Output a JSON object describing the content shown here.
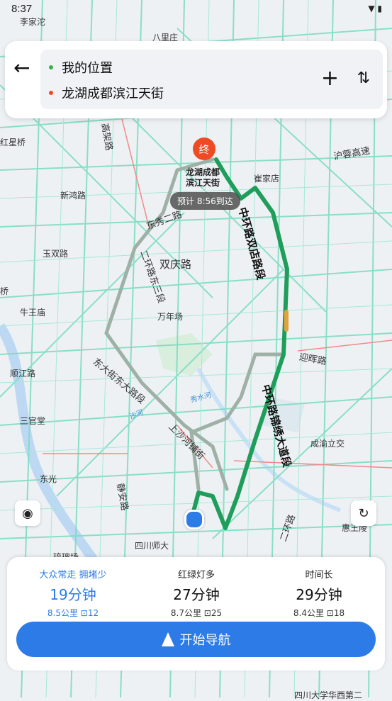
{
  "status": {
    "time": "8:37"
  },
  "search": {
    "origin": "我的位置",
    "destination": "龙湖成都滨江天街",
    "origin_color": "#2fb34a",
    "destination_color": "#f04a25"
  },
  "map": {
    "labels": [
      "李家沱",
      "八里庄",
      "红星桥",
      "新鸿路",
      "玉双路",
      "牛王庙",
      "顺江路",
      "三官堂",
      "东光",
      "高架路",
      "东秀二路",
      "双庆路",
      "万年场",
      "崔家店",
      "沪蓉高速",
      "迎晖路",
      "成渝立交",
      "秀水河",
      "沙河",
      "静安路",
      "四川师大",
      "惠王陵",
      "二环路",
      "桥",
      "琉璃场",
      "四川大学华西第二"
    ],
    "route_labels": [
      "中环路双店路段",
      "中环路锦绣大道段",
      "二环路东三段",
      "东大街东大路段",
      "上沙河铺街"
    ],
    "end_pin": "终",
    "end_name_line1": "龙湖成都",
    "end_name_line2": "滨江天街",
    "eta": "预计 8:56到达",
    "route_color": "#1f9d5a"
  },
  "routes": [
    {
      "tag": "大众常走 拥堵少",
      "time": "19分钟",
      "distance": "8.5公里",
      "lights": "12",
      "selected": true
    },
    {
      "tag": "红绿灯多",
      "time": "27分钟",
      "distance": "8.7公里",
      "lights": "25",
      "selected": false
    },
    {
      "tag": "时间长",
      "time": "29分钟",
      "distance": "8.4公里",
      "lights": "18",
      "selected": false
    }
  ],
  "nav_button": {
    "label": "开始导航",
    "color": "#2d7be6"
  }
}
